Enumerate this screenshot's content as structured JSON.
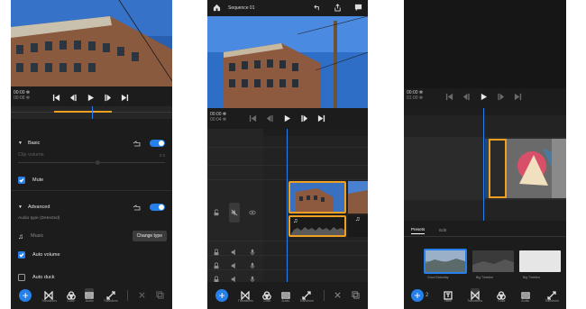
{
  "screen1": {
    "time_current": "00:00 ✻",
    "time_total": "00:08 ✻",
    "basic_section": "Basic",
    "clip_volume": "Clip volume",
    "mute": "Mute",
    "advanced_section": "Advanced",
    "audio_type_label": "Audio type (Detected)",
    "music": "Music",
    "change_type": "Change type",
    "auto_volume": "Auto volume",
    "auto_duck": "Auto duck",
    "bar_tools": [
      "Transitions",
      "Color",
      "Audio",
      "Transform"
    ]
  },
  "screen2": {
    "title": "Sequence 01",
    "time_current": "00:00 ✻",
    "time_total": "00:04 ✻",
    "bar_tools": [
      "Transitions",
      "Color",
      "Audio",
      "Transform"
    ]
  },
  "screen3": {
    "time_current": "00:00 ✻",
    "time_total": "01:00 ✻",
    "tabs": [
      "Presets",
      "Edit"
    ],
    "presets": [
      "Good Saturday",
      "Big Timeline",
      "Big Timeline"
    ],
    "bar_tools": [
      "Titles",
      "Transitions",
      "Color",
      "Audio",
      "Transform"
    ]
  },
  "colors": {
    "accent": "#2680eb",
    "clip_border": "#f0a020",
    "playhead": "#2680eb"
  }
}
